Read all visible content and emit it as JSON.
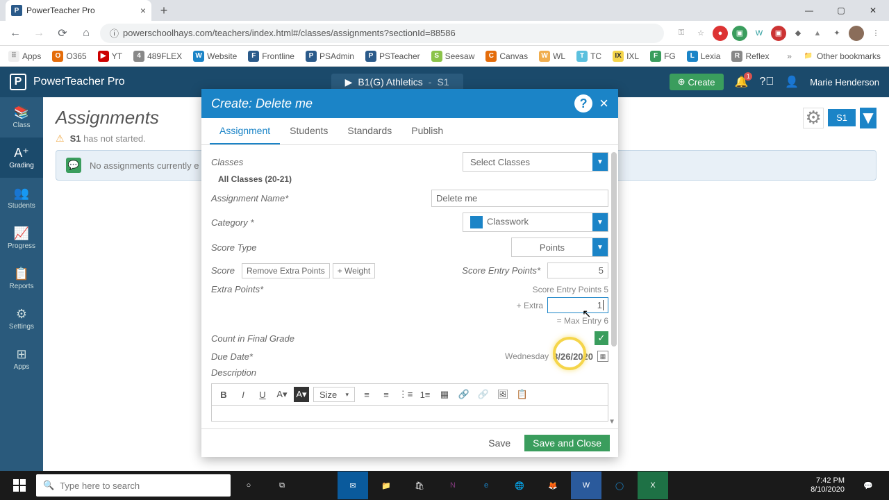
{
  "browser": {
    "tab_title": "PowerTeacher Pro",
    "url": "powerschoolhays.com/teachers/index.html#/classes/assignments?sectionId=88586",
    "other_bookmarks_label": "Other bookmarks"
  },
  "bookmarks": [
    {
      "label": "Apps",
      "color": "#888"
    },
    {
      "label": "O365",
      "color": "#e46c0a"
    },
    {
      "label": "YT",
      "color": "#cc0000"
    },
    {
      "label": "489FLEX",
      "color": "#888"
    },
    {
      "label": "Website",
      "color": "#1b84c7"
    },
    {
      "label": "Frontline",
      "color": "#2a5a8a"
    },
    {
      "label": "PSAdmin",
      "color": "#2a5a8a"
    },
    {
      "label": "PSTeacher",
      "color": "#2a5a8a"
    },
    {
      "label": "Seesaw",
      "color": "#8bc34a"
    },
    {
      "label": "Canvas",
      "color": "#e46c0a"
    },
    {
      "label": "WL",
      "color": "#f0ad4e"
    },
    {
      "label": "TC",
      "color": "#5bc0de"
    },
    {
      "label": "IXL",
      "color": "#3a9d5d"
    },
    {
      "label": "FG",
      "color": "#3a9d5d"
    },
    {
      "label": "Lexia",
      "color": "#1b84c7"
    },
    {
      "label": "Reflex",
      "color": "#888"
    }
  ],
  "app_header": {
    "brand": "PowerTeacher Pro",
    "class_name": "B1(G) Athletics",
    "term": "S1",
    "create_label": "Create",
    "user_name": "Marie Henderson",
    "notif_count": "1"
  },
  "sidebar": {
    "items": [
      {
        "label": "Class"
      },
      {
        "label": "Grading"
      },
      {
        "label": "Students"
      },
      {
        "label": "Progress"
      },
      {
        "label": "Reports"
      },
      {
        "label": "Settings"
      },
      {
        "label": "Apps"
      }
    ]
  },
  "page": {
    "title": "Assignments",
    "term_pill": "S1",
    "warn_text_prefix": "S1",
    "warn_text_suffix": " has not started.",
    "info_text": "No assignments currently e"
  },
  "modal": {
    "title": "Create: Delete me",
    "tabs": [
      "Assignment",
      "Students",
      "Standards",
      "Publish"
    ],
    "labels": {
      "classes": "Classes",
      "all_classes": "All Classes   (20-21)",
      "select_classes": "Select Classes",
      "name": "Assignment Name*",
      "name_val": "Delete me",
      "category": "Category *",
      "category_val": "Classwork",
      "score_type": "Score Type",
      "score_type_val": "Points",
      "score": "Score",
      "remove_extra": "Remove Extra Points",
      "add_weight": "+ Weight",
      "entry_points": "Score Entry Points*",
      "entry_points_val": "5",
      "extra_points": "Extra Points*",
      "extra_pts_line": "Score Entry Points 5",
      "extra_plus": "+ Extra",
      "extra_val": "1",
      "max_line": "= Max Entry 6",
      "count_final": "Count in Final Grade",
      "due_date": "Due Date*",
      "due_day": "Wednesday",
      "due_val": "8/26/2020",
      "description": "Description",
      "size_label": "Size"
    },
    "footer": {
      "save": "Save",
      "save_close": "Save and Close"
    }
  },
  "taskbar": {
    "search_placeholder": "Type here to search",
    "time": "7:42 PM",
    "date": "8/10/2020"
  }
}
